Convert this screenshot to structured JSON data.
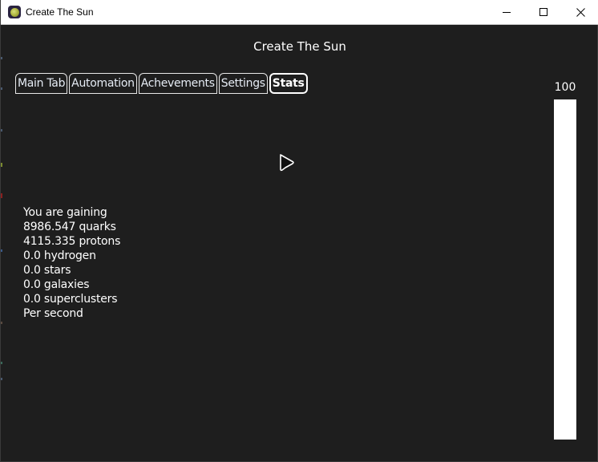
{
  "window": {
    "title": "Create The Sun",
    "icon": "sun-app-icon",
    "controls": {
      "minimize": "minimize-icon",
      "maximize": "maximize-icon",
      "close": "close-icon"
    }
  },
  "header": {
    "title": "Create The Sun"
  },
  "tabs": [
    {
      "label": "Main Tab",
      "active": false
    },
    {
      "label": "Automation",
      "active": false
    },
    {
      "label": "Achevements",
      "active": false
    },
    {
      "label": "Settings",
      "active": false
    },
    {
      "label": "Stats",
      "active": true
    }
  ],
  "stats": {
    "intro": "You are gaining",
    "lines": [
      "8986.547 quarks",
      "4115.335 protons",
      "0.0 hydrogen",
      "0.0 stars",
      "0.0 galaxies",
      "0.0 superclusters"
    ],
    "outro": "Per second"
  },
  "meter": {
    "label": "100",
    "value": 100,
    "max": 100
  },
  "colors": {
    "background": "#1e1e1e",
    "text": "#ffffff",
    "titlebar": "#ffffff"
  }
}
